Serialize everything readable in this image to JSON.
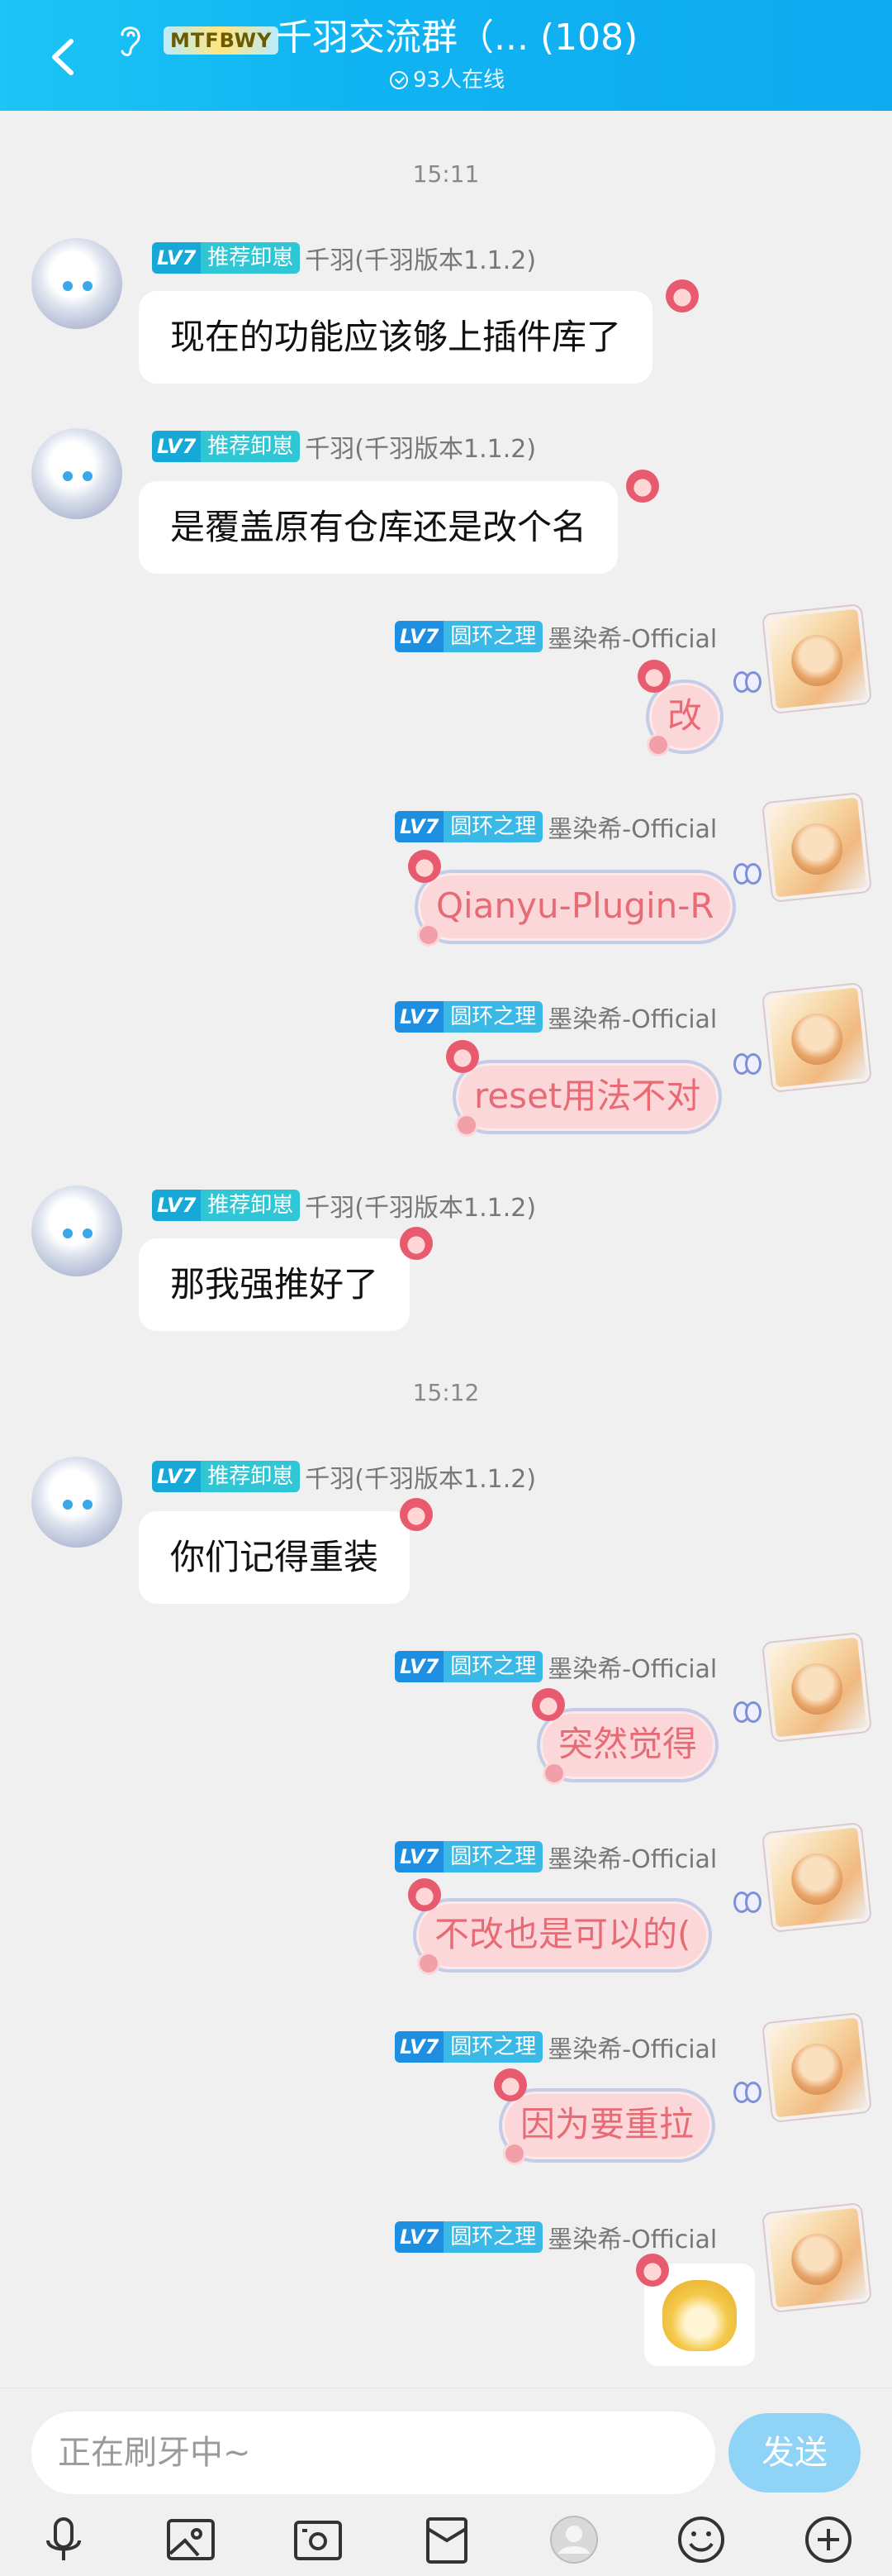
{
  "header": {
    "badge": "MTFBWY",
    "title": "千羽交流群（... (108)",
    "online": "93人在线"
  },
  "messages": {
    "time1": "15:11",
    "time2": "15:12",
    "left_level": "LV7",
    "left_title": "推荐卸崽",
    "left_nick": "千羽(千羽版本1.1.2)",
    "right_level": "LV7",
    "right_title": "圆环之理",
    "right_nick": "墨染希-Official",
    "m1": "现在的功能应该够上插件库了",
    "m2": "是覆盖原有仓库还是改个名",
    "m3": "改",
    "m4": "Qianyu-Plugin-R",
    "m5": "reset用法不对",
    "m6": "那我强推好了",
    "m7": "你们记得重装",
    "m8": "突然觉得",
    "m9": "不改也是可以的(",
    "m10": "因为要重拉"
  },
  "composer": {
    "placeholder": "正在刷牙中~",
    "send_label": "发送"
  },
  "toolbar": {
    "items": [
      "microphone-icon",
      "image-icon",
      "camera-icon",
      "red-packet-icon",
      "avatar-icon",
      "emoji-icon",
      "plus-icon"
    ]
  },
  "colors": {
    "header": "#10b4f2",
    "bubble_right": "#fbd7d9",
    "bubble_right_text": "#e76a75",
    "send": "#8fd3f6"
  }
}
